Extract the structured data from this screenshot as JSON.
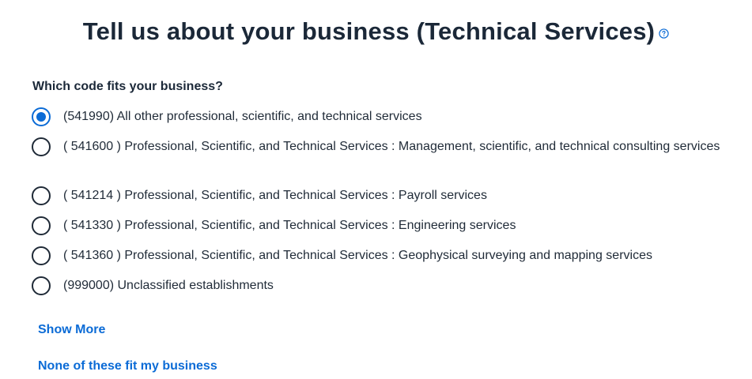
{
  "header": {
    "title": "Tell us about your business (Technical Services)",
    "help_icon": "question-circle-icon"
  },
  "question": "Which code fits your business?",
  "options": [
    {
      "label": "(541990) All other professional, scientific, and technical services",
      "checked": true
    },
    {
      "label": "( 541600 ) Professional, Scientific, and Technical Services : Management, scientific, and technical consulting services",
      "checked": false
    },
    {
      "label": "( 541214 ) Professional, Scientific, and Technical Services : Payroll services",
      "checked": false
    },
    {
      "label": "( 541330 ) Professional, Scientific, and Technical Services : Engineering services",
      "checked": false
    },
    {
      "label": "( 541360 ) Professional, Scientific, and Technical Services : Geophysical surveying and mapping services",
      "checked": false
    },
    {
      "label": "(999000) Unclassified establishments",
      "checked": false
    }
  ],
  "links": {
    "show_more": "Show More",
    "none_fit": "None of these fit my business"
  },
  "colors": {
    "accent": "#0b6bd6",
    "text": "#1f2a37"
  }
}
